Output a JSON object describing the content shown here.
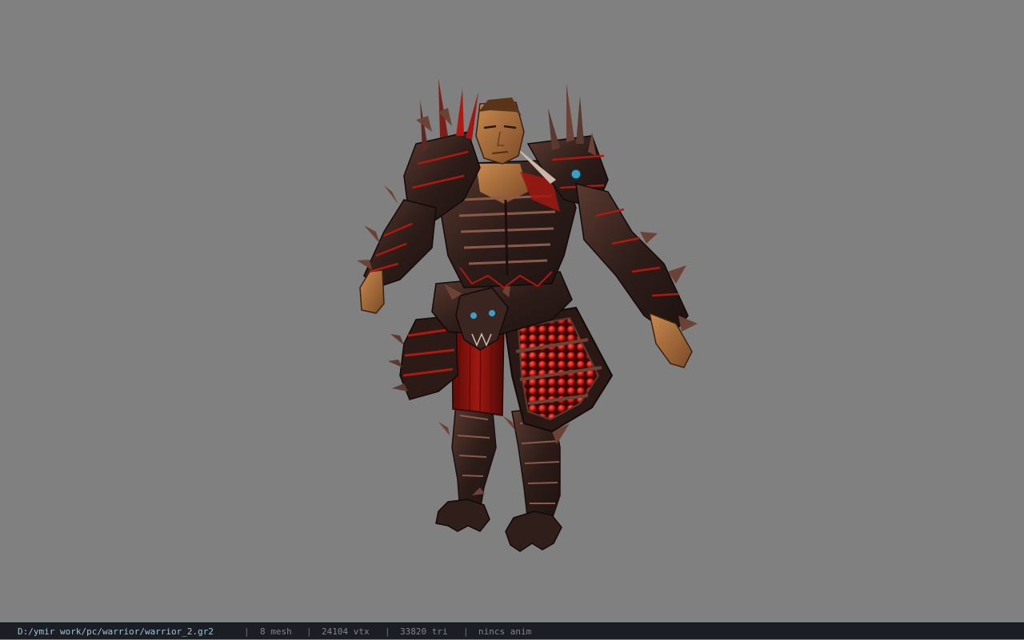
{
  "viewport": {
    "background_color": "#808080",
    "model": {
      "description_icon": "armored-warrior-model",
      "palette": {
        "armor_dark": "#2a1b18",
        "armor_mid": "#4a2f28",
        "armor_edge": "#8a5a4a",
        "red_accent": "#b01810",
        "red_bright": "#d8281c",
        "skin": "#b8763e",
        "skin_dark": "#7a4a26",
        "gem_blue": "#3aa0c8"
      }
    }
  },
  "status_bar": {
    "file_path": "D:/ymir work/pc/warrior/warrior_2.gr2",
    "separator": "|",
    "mesh_count": "8 mesh",
    "vertex_count": "24104 vtx",
    "triangle_count": "33820 tri",
    "anim_status": "nincs anim",
    "colors": {
      "background": "#1b1f23",
      "path_text": "#9fc3d9",
      "stat_text": "#7d868d"
    }
  }
}
